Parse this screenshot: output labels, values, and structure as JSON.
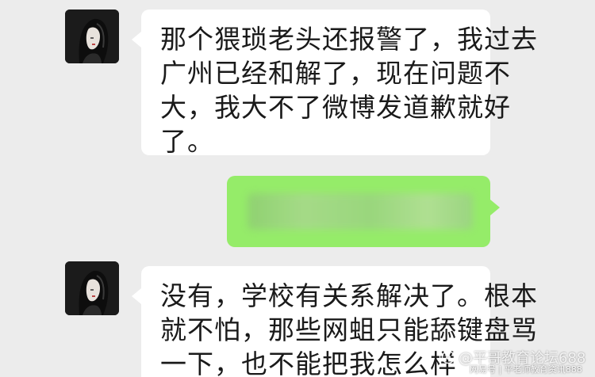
{
  "messages": [
    {
      "sender": "other",
      "lines": [
        "那个猥琐老头还报警了，我过去",
        "广州已经和解了，现在问题不",
        "大，我大不了微博发道歉就好",
        "了。"
      ]
    },
    {
      "sender": "self",
      "blurred": true
    },
    {
      "sender": "other",
      "lines": [
        "没有，学校有关系解决了。根本",
        "就不怕，那些网蛆只能舔键盘骂",
        "一下，也不能把我怎么样"
      ]
    }
  ],
  "watermark": {
    "main": "@平哥教育论坛688",
    "sub": "网易号 | 平老师教育资讯888"
  },
  "colors": {
    "background": "#ececec",
    "incoming_bubble": "#ffffff",
    "outgoing_bubble": "#95ec69"
  },
  "icons": {
    "avatar": "dark-haired-woman-avatar",
    "watermark": "watermark-logo-icon"
  }
}
